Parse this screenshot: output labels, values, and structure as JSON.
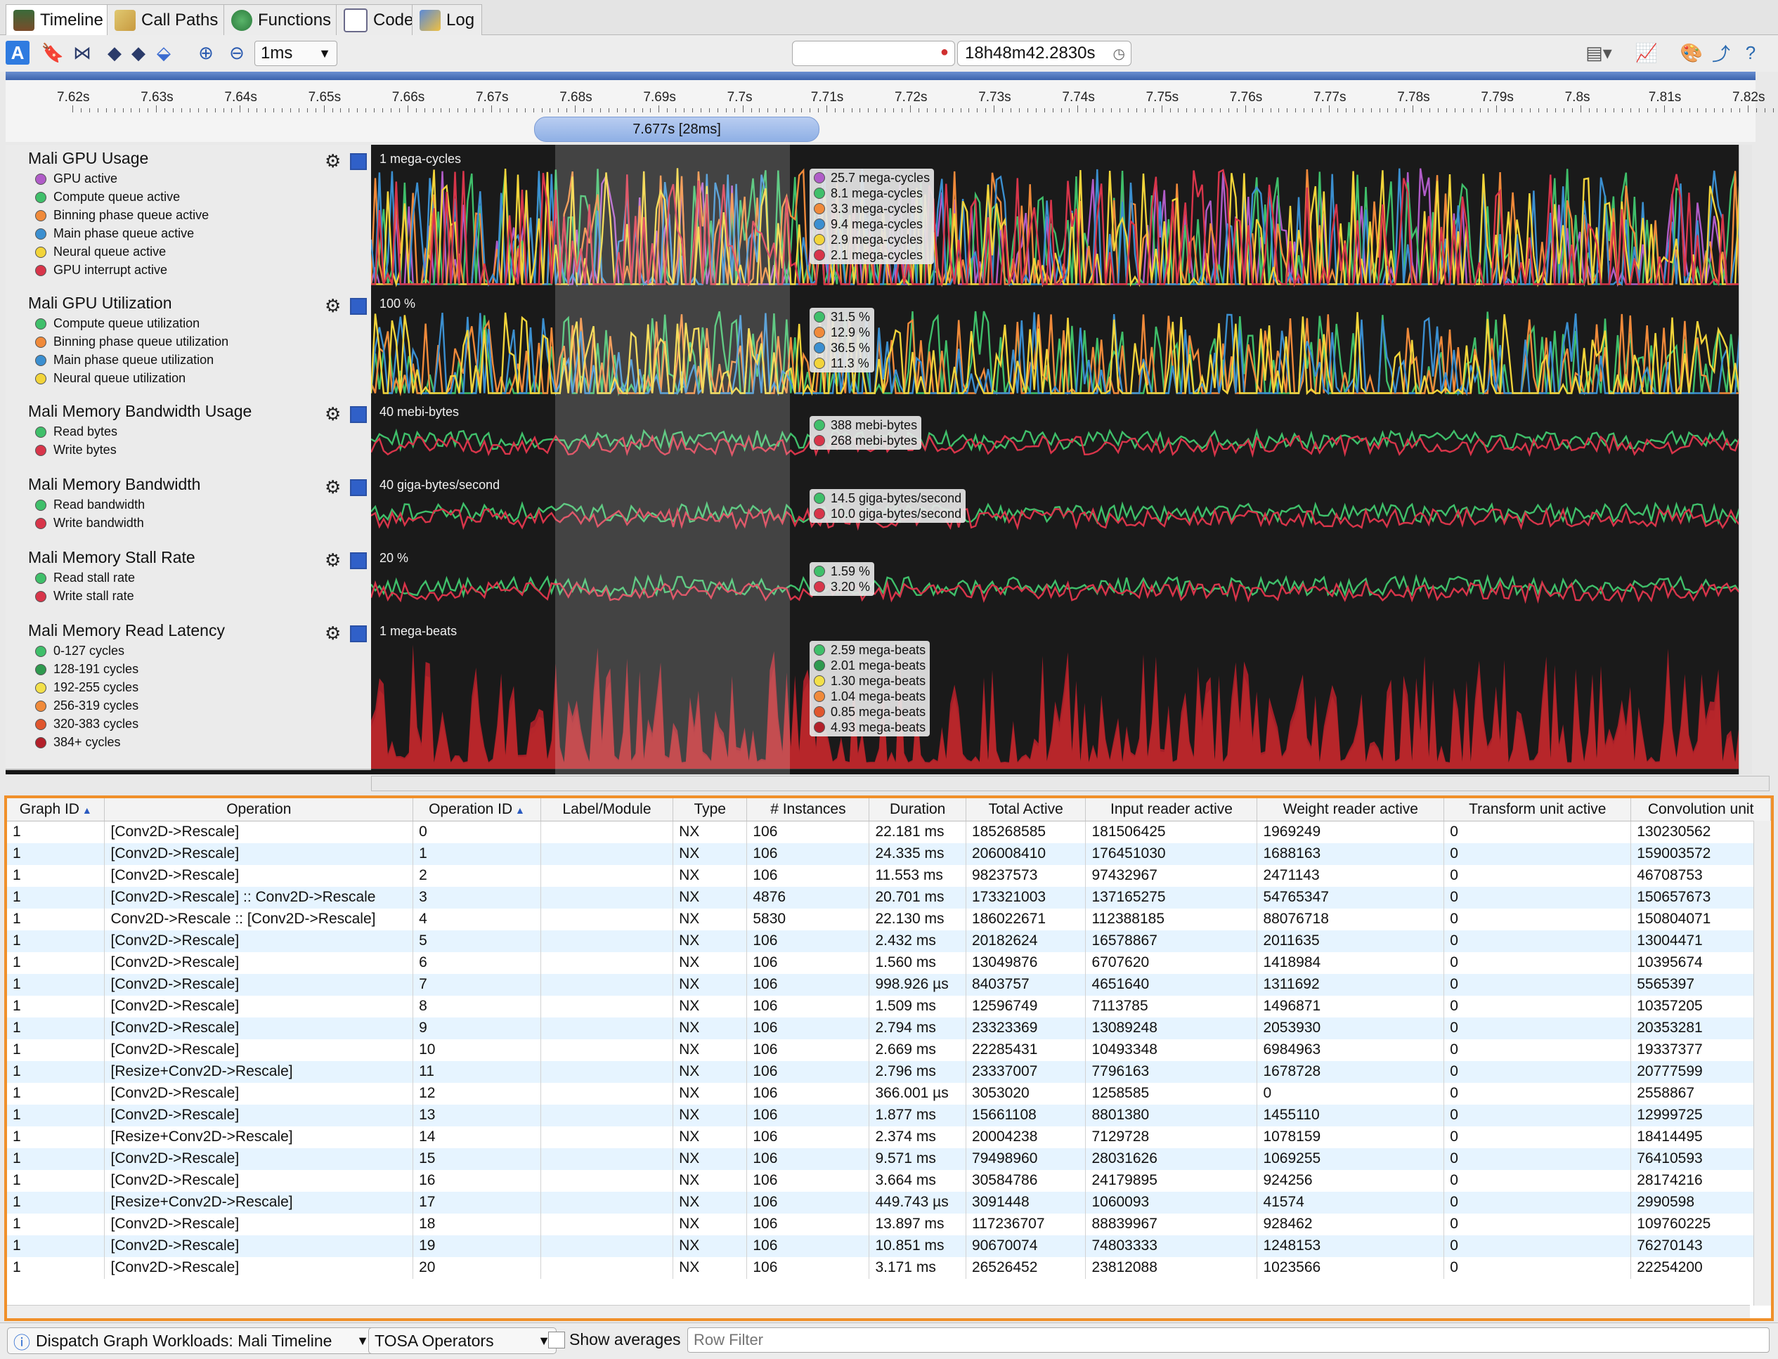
{
  "tabs": [
    {
      "label": "Timeline",
      "icon": "timeline-icon",
      "active": true
    },
    {
      "label": "Call Paths",
      "icon": "call-paths-icon",
      "active": false
    },
    {
      "label": "Functions",
      "icon": "functions-icon",
      "active": false
    },
    {
      "label": "Code",
      "icon": "code-icon",
      "active": false
    },
    {
      "label": "Log",
      "icon": "log-icon",
      "active": false
    }
  ],
  "toolbar": {
    "zoom": "1ms",
    "time": "18h48m42.2830s"
  },
  "ruler": {
    "ticks": [
      "7.62s",
      "7.63s",
      "7.64s",
      "7.65s",
      "7.66s",
      "7.67s",
      "7.68s",
      "7.69s",
      "7.7s",
      "7.71s",
      "7.72s",
      "7.73s",
      "7.74s",
      "7.75s",
      "7.76s",
      "7.77s",
      "7.78s",
      "7.79s",
      "7.8s",
      "7.81s",
      "7.82s"
    ],
    "selection": "7.677s [28ms]"
  },
  "tracks": [
    {
      "title": "Mali GPU Usage",
      "scale": "1 mega-cycles",
      "legend": [
        {
          "label": "GPU active",
          "color": "#b05cc8"
        },
        {
          "label": "Compute queue active",
          "color": "#3fbf6a"
        },
        {
          "label": "Binning phase queue active",
          "color": "#f08a3a"
        },
        {
          "label": "Main phase queue active",
          "color": "#3b8fd0"
        },
        {
          "label": "Neural queue active",
          "color": "#f2d43a"
        },
        {
          "label": "GPU interrupt active",
          "color": "#d8354a"
        }
      ],
      "tooltip": [
        {
          "value": "25.7 mega-cycles",
          "color": "#b05cc8"
        },
        {
          "value": "8.1 mega-cycles",
          "color": "#3fbf6a"
        },
        {
          "value": "3.3 mega-cycles",
          "color": "#f08a3a"
        },
        {
          "value": "9.4 mega-cycles",
          "color": "#3b8fd0"
        },
        {
          "value": "2.9 mega-cycles",
          "color": "#f2d43a"
        },
        {
          "value": "2.1 mega-cycles",
          "color": "#d8354a"
        }
      ]
    },
    {
      "title": "Mali GPU Utilization",
      "scale": "100 %",
      "legend": [
        {
          "label": "Compute queue utilization",
          "color": "#3fbf6a"
        },
        {
          "label": "Binning phase queue utilization",
          "color": "#f08a3a"
        },
        {
          "label": "Main phase queue utilization",
          "color": "#3b8fd0"
        },
        {
          "label": "Neural queue utilization",
          "color": "#f2d43a"
        }
      ],
      "tooltip": [
        {
          "value": "31.5 %",
          "color": "#3fbf6a"
        },
        {
          "value": "12.9 %",
          "color": "#f08a3a"
        },
        {
          "value": "36.5 %",
          "color": "#3b8fd0"
        },
        {
          "value": "11.3 %",
          "color": "#f2d43a"
        }
      ]
    },
    {
      "title": "Mali Memory Bandwidth Usage",
      "scale": "40 mebi-bytes",
      "legend": [
        {
          "label": "Read bytes",
          "color": "#3fbf6a"
        },
        {
          "label": "Write bytes",
          "color": "#d8354a"
        }
      ],
      "tooltip": [
        {
          "value": "388 mebi-bytes",
          "color": "#3fbf6a"
        },
        {
          "value": "268 mebi-bytes",
          "color": "#d8354a"
        }
      ]
    },
    {
      "title": "Mali Memory Bandwidth",
      "scale": "40 giga-bytes/second",
      "legend": [
        {
          "label": "Read bandwidth",
          "color": "#3fbf6a"
        },
        {
          "label": "Write bandwidth",
          "color": "#d8354a"
        }
      ],
      "tooltip": [
        {
          "value": "14.5 giga-bytes/second",
          "color": "#3fbf6a"
        },
        {
          "value": "10.0 giga-bytes/second",
          "color": "#d8354a"
        }
      ]
    },
    {
      "title": "Mali Memory Stall Rate",
      "scale": "20 %",
      "legend": [
        {
          "label": "Read stall rate",
          "color": "#3fbf6a"
        },
        {
          "label": "Write stall rate",
          "color": "#d8354a"
        }
      ],
      "tooltip": [
        {
          "value": "1.59 %",
          "color": "#3fbf6a"
        },
        {
          "value": "3.20 %",
          "color": "#d8354a"
        }
      ]
    },
    {
      "title": "Mali Memory Read Latency",
      "scale": "1 mega-beats",
      "legend": [
        {
          "label": "0-127 cycles",
          "color": "#3fbf6a"
        },
        {
          "label": "128-191 cycles",
          "color": "#2f9a4f"
        },
        {
          "label": "192-255 cycles",
          "color": "#f2e04a"
        },
        {
          "label": "256-319 cycles",
          "color": "#f08a3a"
        },
        {
          "label": "320-383 cycles",
          "color": "#e0562e"
        },
        {
          "label": "384+ cycles",
          "color": "#b3202a"
        }
      ],
      "tooltip": [
        {
          "value": "2.59 mega-beats",
          "color": "#3fbf6a"
        },
        {
          "value": "2.01 mega-beats",
          "color": "#2f9a4f"
        },
        {
          "value": "1.30 mega-beats",
          "color": "#f2e04a"
        },
        {
          "value": "1.04 mega-beats",
          "color": "#f08a3a"
        },
        {
          "value": "0.85 mega-beats",
          "color": "#e0562e"
        },
        {
          "value": "4.93 mega-beats",
          "color": "#b3202a"
        }
      ]
    }
  ],
  "table": {
    "columns": [
      "Graph ID",
      "Operation",
      "Operation ID",
      "Label/Module",
      "Type",
      "# Instances",
      "Duration",
      "Total Active",
      "Input reader active",
      "Weight reader active",
      "Transform unit active",
      "Convolution unit"
    ],
    "rows": [
      [
        "1",
        "[Conv2D->Rescale]",
        "0",
        "",
        "NX",
        "106",
        "22.181 ms",
        "185268585",
        "181506425",
        "1969249",
        "0",
        "130230562"
      ],
      [
        "1",
        "[Conv2D->Rescale]",
        "1",
        "",
        "NX",
        "106",
        "24.335 ms",
        "206008410",
        "176451030",
        "1688163",
        "0",
        "159003572"
      ],
      [
        "1",
        "[Conv2D->Rescale]",
        "2",
        "",
        "NX",
        "106",
        "11.553 ms",
        "98237573",
        "97432967",
        "2471143",
        "0",
        "46708753"
      ],
      [
        "1",
        "[Conv2D->Rescale] :: Conv2D->Rescale",
        "3",
        "",
        "NX",
        "4876",
        "20.701 ms",
        "173321003",
        "137165275",
        "54765347",
        "0",
        "150657673"
      ],
      [
        "1",
        "Conv2D->Rescale :: [Conv2D->Rescale]",
        "4",
        "",
        "NX",
        "5830",
        "22.130 ms",
        "186022671",
        "112388185",
        "88076718",
        "0",
        "150804071"
      ],
      [
        "1",
        "[Conv2D->Rescale]",
        "5",
        "",
        "NX",
        "106",
        "2.432 ms",
        "20182624",
        "16578867",
        "2011635",
        "0",
        "13004471"
      ],
      [
        "1",
        "[Conv2D->Rescale]",
        "6",
        "",
        "NX",
        "106",
        "1.560 ms",
        "13049876",
        "6707620",
        "1418984",
        "0",
        "10395674"
      ],
      [
        "1",
        "[Conv2D->Rescale]",
        "7",
        "",
        "NX",
        "106",
        "998.926 µs",
        "8403757",
        "4651640",
        "1311692",
        "0",
        "5565397"
      ],
      [
        "1",
        "[Conv2D->Rescale]",
        "8",
        "",
        "NX",
        "106",
        "1.509 ms",
        "12596749",
        "7113785",
        "1496871",
        "0",
        "10357205"
      ],
      [
        "1",
        "[Conv2D->Rescale]",
        "9",
        "",
        "NX",
        "106",
        "2.794 ms",
        "23323369",
        "13089248",
        "2053930",
        "0",
        "20353281"
      ],
      [
        "1",
        "[Conv2D->Rescale]",
        "10",
        "",
        "NX",
        "106",
        "2.669 ms",
        "22285431",
        "10493348",
        "6984963",
        "0",
        "19337377"
      ],
      [
        "1",
        "[Resize+Conv2D->Rescale]",
        "11",
        "",
        "NX",
        "106",
        "2.796 ms",
        "23337007",
        "7796163",
        "1678728",
        "0",
        "20777599"
      ],
      [
        "1",
        "[Conv2D->Rescale]",
        "12",
        "",
        "NX",
        "106",
        "366.001 µs",
        "3053020",
        "1258585",
        "0",
        "0",
        "2558867"
      ],
      [
        "1",
        "[Conv2D->Rescale]",
        "13",
        "",
        "NX",
        "106",
        "1.877 ms",
        "15661108",
        "8801380",
        "1455110",
        "0",
        "12999725"
      ],
      [
        "1",
        "[Resize+Conv2D->Rescale]",
        "14",
        "",
        "NX",
        "106",
        "2.374 ms",
        "20004238",
        "7129728",
        "1078159",
        "0",
        "18414495"
      ],
      [
        "1",
        "[Conv2D->Rescale]",
        "15",
        "",
        "NX",
        "106",
        "9.571 ms",
        "79498960",
        "28031626",
        "1069255",
        "0",
        "76410593"
      ],
      [
        "1",
        "[Conv2D->Rescale]",
        "16",
        "",
        "NX",
        "106",
        "3.664 ms",
        "30584786",
        "24179895",
        "924256",
        "0",
        "28174216"
      ],
      [
        "1",
        "[Resize+Conv2D->Rescale]",
        "17",
        "",
        "NX",
        "106",
        "449.743 µs",
        "3091448",
        "1060093",
        "41574",
        "0",
        "2990598"
      ],
      [
        "1",
        "[Conv2D->Rescale]",
        "18",
        "",
        "NX",
        "106",
        "13.897 ms",
        "117236707",
        "88839967",
        "928462",
        "0",
        "109760225"
      ],
      [
        "1",
        "[Conv2D->Rescale]",
        "19",
        "",
        "NX",
        "106",
        "10.851 ms",
        "90670074",
        "74803333",
        "1248153",
        "0",
        "76270143"
      ],
      [
        "1",
        "[Conv2D->Rescale]",
        "20",
        "",
        "NX",
        "106",
        "3.171 ms",
        "26526452",
        "23812088",
        "1023566",
        "0",
        "22254200"
      ]
    ]
  },
  "statusbar": {
    "view_select": "Dispatch Graph Workloads: Mali Timeline",
    "mode_select": "TOSA Operators",
    "show_averages": "Show averages",
    "filter_placeholder": "Row Filter"
  }
}
